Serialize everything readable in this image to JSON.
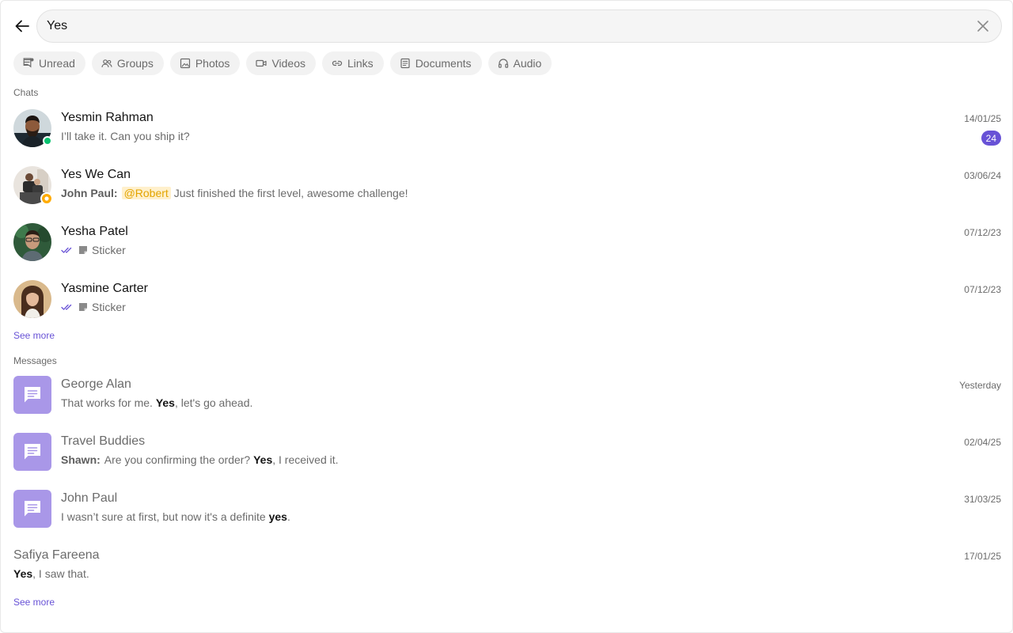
{
  "search": {
    "value": "Yes"
  },
  "filters": [
    {
      "label": "Unread",
      "icon": "unread-icon"
    },
    {
      "label": "Groups",
      "icon": "groups-icon"
    },
    {
      "label": "Photos",
      "icon": "photo-icon"
    },
    {
      "label": "Videos",
      "icon": "video-icon"
    },
    {
      "label": "Links",
      "icon": "link-icon"
    },
    {
      "label": "Documents",
      "icon": "document-icon"
    },
    {
      "label": "Audio",
      "icon": "headphones-icon"
    }
  ],
  "chats": {
    "title": "Chats",
    "see_more": "See more",
    "items": [
      {
        "name": "Yesmin Rahman",
        "message": "I’ll take it. Can you ship it?",
        "date": "14/01/25",
        "unread": "24",
        "status": "online"
      },
      {
        "name": "Yes We Can",
        "sender": "John Paul:",
        "mention": "@Robert",
        "message": "Just finished the first level, awesome challenge!",
        "date": "03/06/24",
        "badge": "group"
      },
      {
        "name": "Yesha Patel",
        "message": "Sticker",
        "date": "07/12/23",
        "receipt": "read"
      },
      {
        "name": "Yasmine Carter",
        "message": "Sticker",
        "date": "07/12/23",
        "receipt": "read"
      }
    ]
  },
  "messages": {
    "title": "Messages",
    "see_more": "See more",
    "items": [
      {
        "name": "George Alan",
        "before": "That works for me. ",
        "match": "Yes",
        "after": ", let's go ahead.",
        "date": "Yesterday"
      },
      {
        "name": "Travel Buddies",
        "sender": "Shawn:",
        "before": "Are you confirming the order? ",
        "match": "Yes",
        "after": ", I received it.",
        "date": "02/04/25"
      },
      {
        "name": "John Paul",
        "before": "I wasn’t sure at first, but now it's a definite ",
        "match": "yes",
        "after": ".",
        "date": "31/03/25"
      },
      {
        "name": "Safiya Fareena",
        "before": "",
        "match": "Yes",
        "after": ", I saw that.",
        "date": "17/01/25"
      }
    ]
  },
  "colors": {
    "accent": "#6852d6",
    "online": "#09c26f",
    "group_badge": "#ffab00",
    "message_tile": "#a997e8",
    "mention_text": "#e3a400",
    "mention_bg": "#fff0cc"
  }
}
